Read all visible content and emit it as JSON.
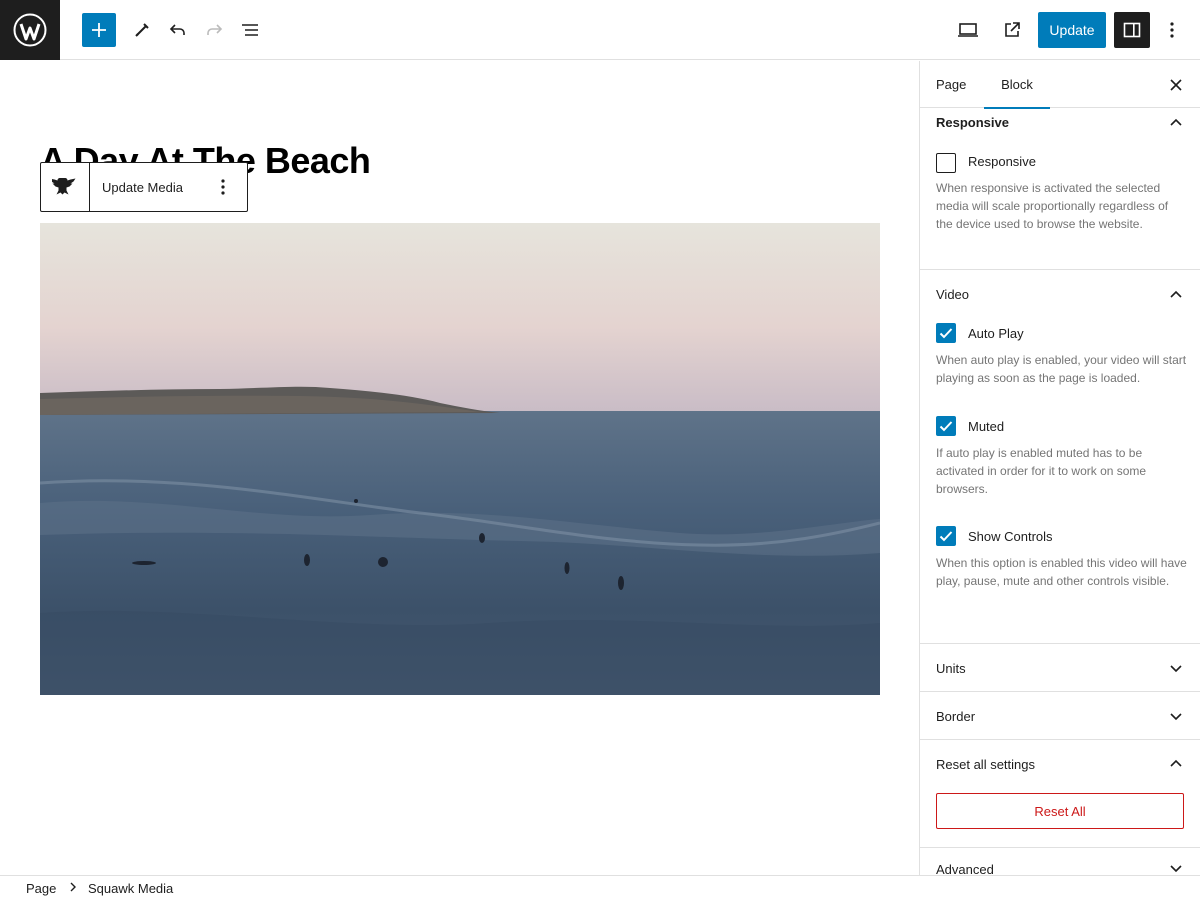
{
  "topbar": {
    "logo_icon": "wordpress-icon",
    "inserter_icon": "plus-icon",
    "tools_icon": "pencil-icon",
    "undo_icon": "undo-icon",
    "redo_icon": "redo-icon",
    "list_view_icon": "list-view-icon",
    "preview_icon": "desktop-icon",
    "view_page_icon": "external-link-icon",
    "update_label": "Update",
    "settings_icon": "sidebar-toggle-icon",
    "options_icon": "more-vertical-icon"
  },
  "canvas": {
    "title": "A Day At The Beach",
    "block_toolbar": {
      "block_icon": "eagle-icon",
      "update_media_label": "Update Media",
      "more_icon": "more-vertical-icon"
    }
  },
  "sidebar": {
    "tabs": [
      {
        "label": "Page"
      },
      {
        "label": "Block"
      }
    ],
    "active_tab": "Block",
    "responsive": {
      "title": "Responsive",
      "checkbox_label": "Responsive",
      "checked": false,
      "help": "When responsive is activated the selected media will scale proportionally regardless of the device used to browse the website."
    },
    "video": {
      "title": "Video",
      "options": [
        {
          "label": "Auto Play",
          "checked": true,
          "help": "When auto play is enabled, your video will start playing as soon as the page is loaded."
        },
        {
          "label": "Muted",
          "checked": true,
          "help": "If auto play is enabled muted has to be activated in order for it to work on some browsers."
        },
        {
          "label": "Show Controls",
          "checked": true,
          "help": "When this option is enabled this video will have play, pause, mute and other controls visible."
        }
      ]
    },
    "units_title": "Units",
    "border_title": "Border",
    "reset": {
      "title": "Reset all settings",
      "button_label": "Reset All"
    },
    "advanced_title": "Advanced"
  },
  "footer": {
    "breadcrumb": [
      "Page",
      "Squawk Media"
    ]
  },
  "colors": {
    "accent": "#007cba",
    "danger": "#cc1818",
    "dark": "#1e1e1e"
  }
}
